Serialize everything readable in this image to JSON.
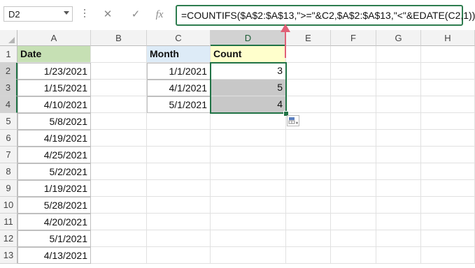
{
  "name_box": {
    "value": "D2"
  },
  "formula_bar": {
    "cancel_icon": "close-icon",
    "enter_icon": "check-icon",
    "fx_label": "fx",
    "formula": "=COUNTIFS($A$2:$A$13,\">=\"&C2,$A$2:$A$13,\"<\"&EDATE(C2,1))"
  },
  "columns": [
    "A",
    "B",
    "C",
    "D",
    "E",
    "F",
    "G",
    "H"
  ],
  "rows": [
    "1",
    "2",
    "3",
    "4",
    "5",
    "6",
    "7",
    "8",
    "9",
    "10",
    "11",
    "12",
    "13"
  ],
  "active_cell": "D2",
  "colors": {
    "header_green": "#c6e0b4",
    "month_blue": "#ddebf7",
    "count_yellow": "#ffffcc",
    "selection_gray": "#c8c8c8",
    "arrow": "#e06076"
  },
  "sheet": {
    "a_header": "Date",
    "dates": [
      "1/23/2021",
      "1/15/2021",
      "4/10/2021",
      "5/8/2021",
      "4/19/2021",
      "4/25/2021",
      "5/2/2021",
      "1/19/2021",
      "5/28/2021",
      "4/20/2021",
      "5/1/2021",
      "4/13/2021"
    ],
    "c_header": "Month",
    "d_header": "Count",
    "months": [
      "1/1/2021",
      "4/1/2021",
      "5/1/2021"
    ],
    "counts": [
      "3",
      "5",
      "4"
    ]
  }
}
